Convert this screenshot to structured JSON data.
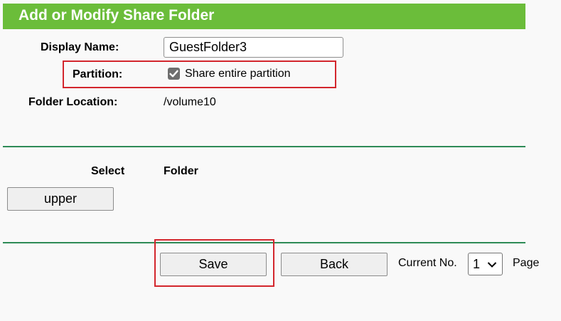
{
  "header": {
    "title": "Add or Modify Share Folder"
  },
  "form": {
    "display_name_label": "Display Name:",
    "display_name_value": "GuestFolder3",
    "partition_label": "Partition:",
    "share_entire_partition_label": "Share entire partition",
    "share_entire_partition_checked": true,
    "folder_location_label": "Folder Location:",
    "folder_location_value": "/volume10"
  },
  "folder_table": {
    "headers": [
      "Select",
      "Folder"
    ],
    "upper_button_label": "upper"
  },
  "footer": {
    "save_label": "Save",
    "back_label": "Back",
    "current_no_label": "Current No.",
    "current_no_value": "1",
    "page_label": "Page"
  },
  "colors": {
    "header_green": "#6bbd3a",
    "highlight_red": "#d3262d",
    "divider_green": "#2e8b57"
  }
}
